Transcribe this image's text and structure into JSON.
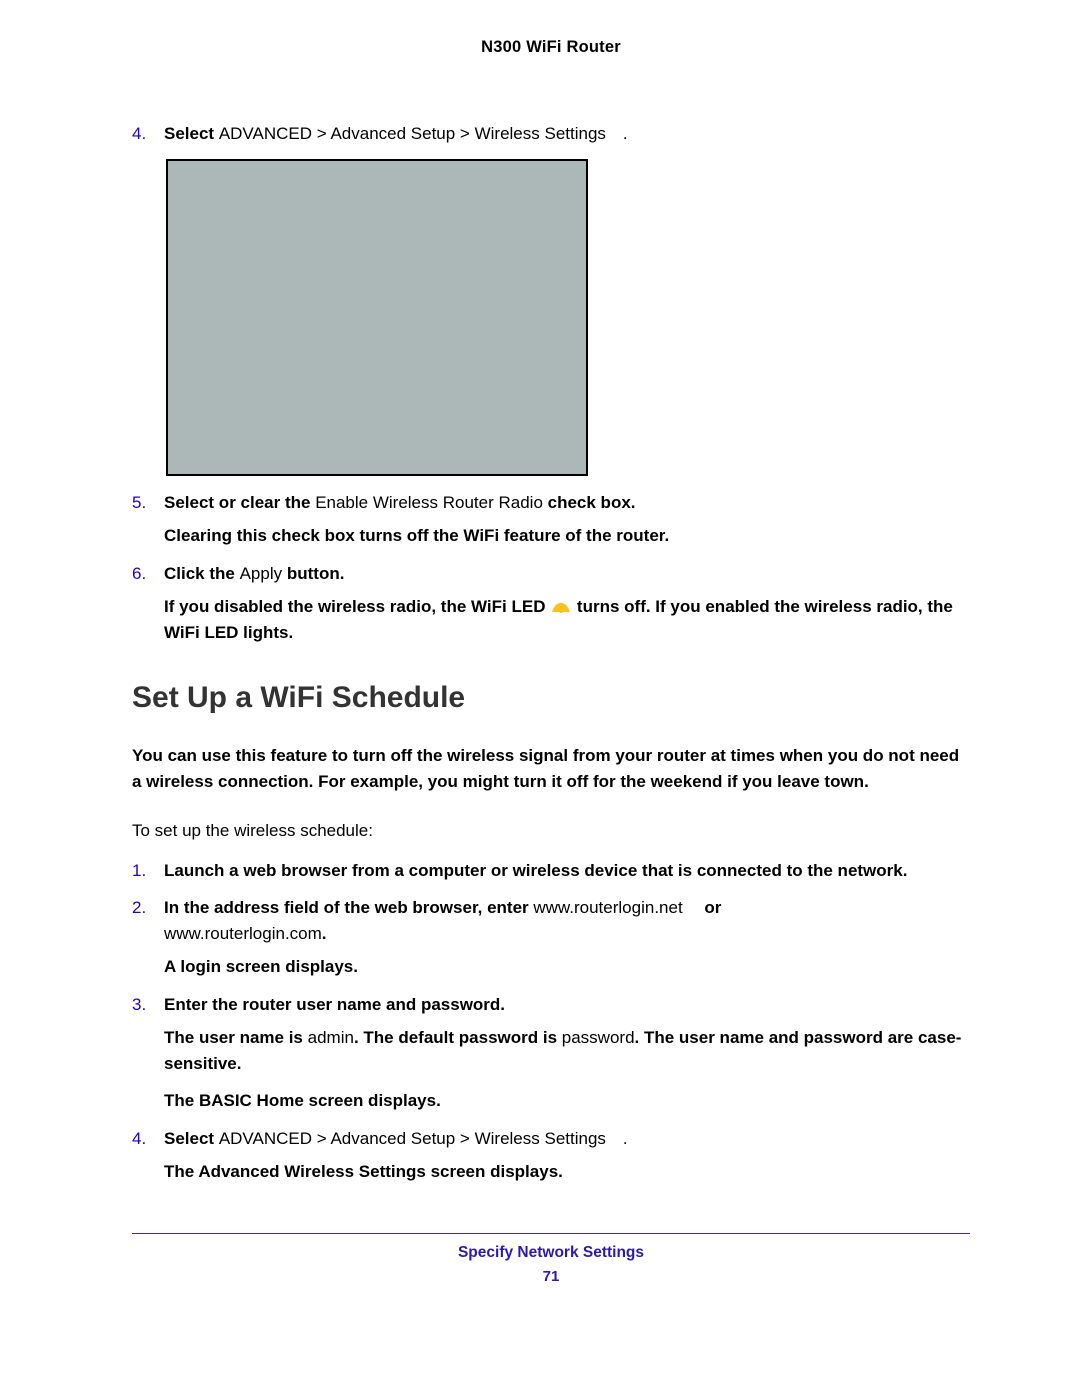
{
  "header": {
    "title": "N300 WiFi Router"
  },
  "stepsA": [
    {
      "marker": "4.",
      "html": "<span class='b'>Select </span>ADVANCED > Advanced Setup > Wireless Settings .",
      "after_image": true
    },
    {
      "marker": "5.",
      "html": "<span class='b'>Select or clear the </span>Enable Wireless Router Radio<span class='b'> check box.</span><p class='b'>Clearing this check box turns off the WiFi feature of the router.</p>"
    },
    {
      "marker": "6.",
      "html": "<span class='b'>Click the </span>Apply<span class='b'> button.</span><p class='b'>If you disabled the wireless radio, the WiFi LED <svg class='wifi-led-icon' data-name='wifi-led-icon' data-interactable='false' viewBox='0 0 22 14'><path d='M2 12 C4 7 6 3 11 3 C16 3 18 7 20 12' stroke='none' fill='#f8c21a'/><circle cx='11' cy='11' r='2' fill='#f8c21a'/></svg> turns off. If you enabled the wireless radio, the WiFi LED lights.</p>"
    }
  ],
  "section": {
    "heading": "Set Up a WiFi Schedule",
    "intro": "You can use this feature to turn off the wireless signal from your router at times when you do not need a wireless connection. For example, you might turn it off for the weekend if you leave town.",
    "lead": "To set up the wireless schedule:"
  },
  "stepsB": [
    {
      "marker": "1.",
      "html": "<span class='b'>Launch a web browser from a computer or wireless device that is connected to the network.</span>"
    },
    {
      "marker": "2.",
      "html": "<span class='b'>In the address field of the web browser, enter </span>www.routerlogin.net <span class='b'> or </span><br>www.routerlogin.com<span class='b'>.</span><p class='b'>A login screen displays.</p>"
    },
    {
      "marker": "3.",
      "html": "<span class='b'>Enter the router user name and password.</span><p><span class='b'>The user name is </span>admin<span class='b'>. The default password is </span>password<span class='b'>. The user name and password are case-sensitive.</span></p><p class='b'>The BASIC Home screen displays.</p>"
    },
    {
      "marker": "4.",
      "html": "<span class='b'>Select </span>ADVANCED > Advanced Setup > Wireless Settings .<p class='b'>The Advanced Wireless Settings screen displays.</p>"
    }
  ],
  "footer": {
    "chapter": "Specify Network Settings",
    "page": "71"
  }
}
